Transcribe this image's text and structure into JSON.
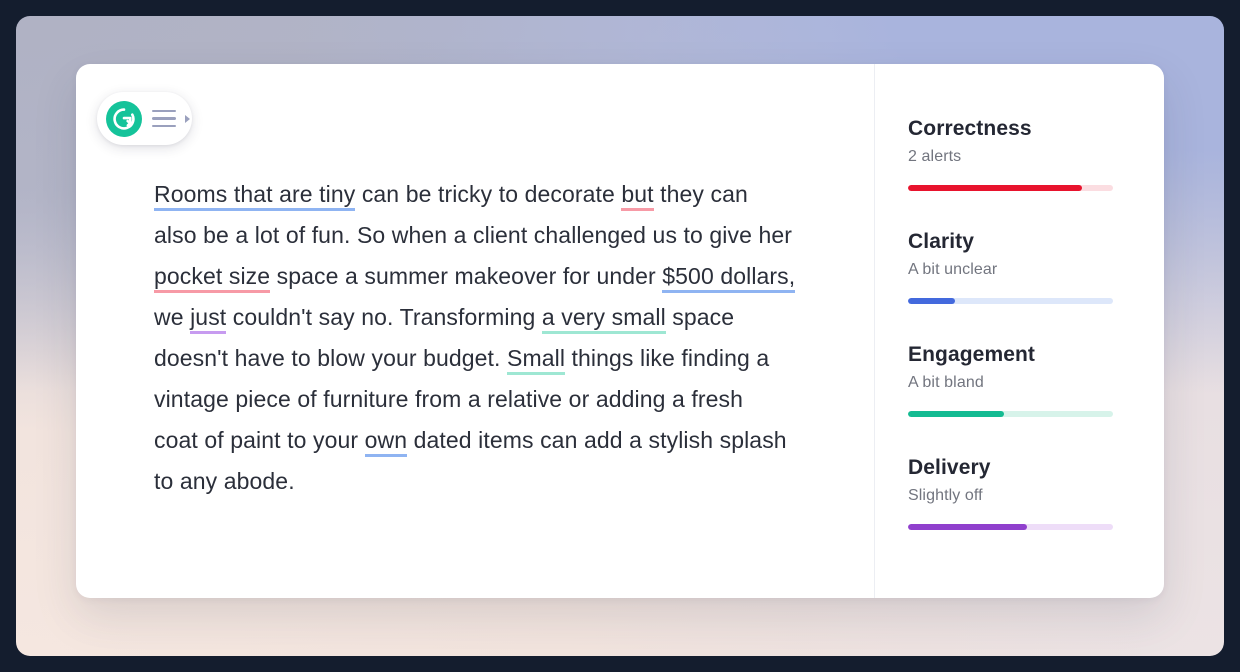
{
  "app": {
    "name": "Grammarly",
    "logo_icon": "grammarly-g-icon",
    "menu_icon": "hamburger-menu-icon",
    "caret_icon": "caret-right-icon"
  },
  "document": {
    "lines": [
      [
        {
          "text": "Rooms that are tiny",
          "mark": "blue"
        },
        {
          "text": " can be tricky to decorate ",
          "mark": null
        },
        {
          "text": "but",
          "mark": "red"
        },
        {
          "text": " they can",
          "mark": null
        }
      ],
      [
        {
          "text": "also be a lot of fun.  So when a client challenged us to give her",
          "mark": null
        }
      ],
      [
        {
          "text": "pocket size",
          "mark": "red"
        },
        {
          "text": " space a summer makeover for under ",
          "mark": null
        },
        {
          "text": "$500 dollars,",
          "mark": "blue"
        }
      ],
      [
        {
          "text": "we ",
          "mark": null
        },
        {
          "text": "just",
          "mark": "purple"
        },
        {
          "text": " couldn't say no. Transforming ",
          "mark": null
        },
        {
          "text": "a very small",
          "mark": "green"
        },
        {
          "text": " space",
          "mark": null
        }
      ],
      [
        {
          "text": "doesn't have to blow your budget. ",
          "mark": null
        },
        {
          "text": "Small",
          "mark": "green"
        },
        {
          "text": " things like finding a",
          "mark": null
        }
      ],
      [
        {
          "text": "vintage piece of furniture from a relative or adding a fresh",
          "mark": null
        }
      ],
      [
        {
          "text": "coat of paint to your ",
          "mark": null
        },
        {
          "text": "own",
          "mark": "blue"
        },
        {
          "text": " dated items can add a stylish splash",
          "mark": null
        }
      ],
      [
        {
          "text": "to any abode.",
          "mark": null
        }
      ]
    ],
    "underline_colors": {
      "blue": "#8fb4f2",
      "red": "#f79aa6",
      "purple": "#c79bf0",
      "green": "#9ee7d3"
    }
  },
  "scores": {
    "metrics": [
      {
        "title": "Correctness",
        "status": "2 alerts",
        "fill_percent": 85,
        "fill_color": "#e8132d",
        "track_color": "#fbdde1",
        "key": "correctness"
      },
      {
        "title": "Clarity",
        "status": "A bit unclear",
        "fill_percent": 23,
        "fill_color": "#4369dd",
        "track_color": "#dde7fa",
        "key": "clarity"
      },
      {
        "title": "Engagement",
        "status": "A bit bland",
        "fill_percent": 47,
        "fill_color": "#14bb92",
        "track_color": "#d7f3ea",
        "key": "engagement"
      },
      {
        "title": "Delivery",
        "status": "Slightly off",
        "fill_percent": 58,
        "fill_color": "#9040cd",
        "track_color": "#eeddf8",
        "key": "delivery"
      }
    ]
  },
  "theme": {
    "brand_green": "#15c39a",
    "card_background": "#ffffff",
    "text_color": "#2b2f3a",
    "frame_color": "#141d2e"
  }
}
